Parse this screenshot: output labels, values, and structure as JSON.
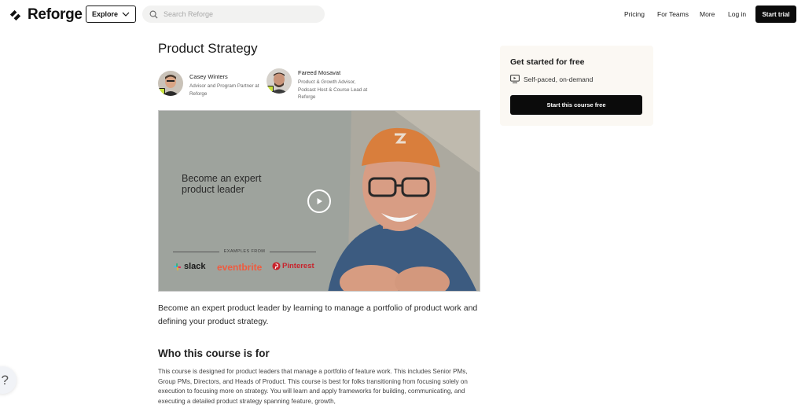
{
  "header": {
    "logo_text": "Reforge",
    "explore_label": "Explore",
    "search_placeholder": "Search Reforge",
    "nav": [
      "Pricing",
      "For Teams",
      "More",
      "Log in"
    ],
    "start_trial_label": "Start trial"
  },
  "course": {
    "title": "Product Strategy",
    "authors": [
      {
        "name": "Casey Winters",
        "role": "Advisor and Program Partner at Reforge"
      },
      {
        "name": "Fareed Mosavat",
        "role": "Product & Growth Advisor, Podcast Host & Course Lead at Reforge"
      }
    ],
    "video": {
      "headline": "Become an expert product leader",
      "examples_label": "EXAMPLES FROM",
      "brands": [
        "slack",
        "eventbrite",
        "Pinterest"
      ]
    },
    "description": "Become an expert product leader by learning to manage a portfolio of product work and defining your product strategy.",
    "section_title": "Who this course is for",
    "section_body": "This course is designed for product leaders that manage a portfolio of feature work. This includes Senior PMs, Group PMs, Directors, and Heads of Product. This course is best for folks transitioning from focusing solely on execution to focusing more on strategy. You will learn and apply frameworks for building, communicating, and executing a detailed product strategy spanning feature, growth,"
  },
  "sidebar": {
    "title": "Get started for free",
    "meta": "Self-paced, on-demand",
    "cta_label": "Start this course free"
  },
  "help": {
    "label": "?"
  },
  "colors": {
    "brand_dark": "#0b0b0b",
    "card_bg": "#fbf8f3",
    "search_bg": "#f2f2f1",
    "accent_orange": "#e2843f",
    "badge_green": "#c9e33d"
  },
  "icons": [
    "reforge-logo-icon",
    "chevron-down-icon",
    "search-icon",
    "monitor-icon",
    "play-icon",
    "help-icon"
  ]
}
